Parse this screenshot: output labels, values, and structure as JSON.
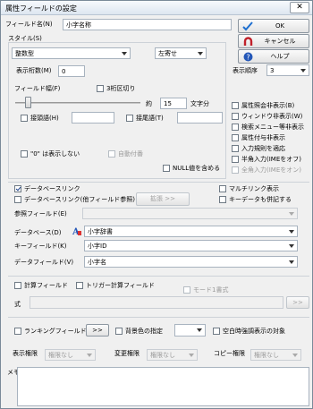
{
  "window": {
    "title": "属性フィールドの設定",
    "close_glyph": "✕"
  },
  "field_name": {
    "label": "フィールド名(N)",
    "value": "小字名称"
  },
  "buttons": {
    "ok": "OK",
    "cancel": "キャンセル",
    "help": "ヘルプ",
    "expand": "拡張 >>",
    "more": ">>"
  },
  "style": {
    "group_label": "スタイル(S)",
    "type_value": "整数型",
    "align_value": "左寄せ",
    "display_digits_label": "表示桁数(M)",
    "display_digits_value": "0",
    "field_width_label": "フィールド幅(F)",
    "thousands_sep_label": "3桁区切り",
    "approx_label": "約",
    "width_value": "15",
    "chars_unit": "文字分",
    "prefix_label": "接頭語(H)",
    "suffix_label": "接尾語(T)",
    "hide_zero_label": "\"0\" は表示しない",
    "auto_number_label": "自動付番",
    "null_include_label": "NULL値を含める"
  },
  "display_order": {
    "label": "表示順序",
    "value": "3"
  },
  "options": [
    {
      "label": "属性照会非表示(B)",
      "checked": false,
      "disabled": false
    },
    {
      "label": "ウィンドウ非表示(W)",
      "checked": false,
      "disabled": false
    },
    {
      "label": "検索メニュー等非表示",
      "checked": false,
      "disabled": false
    },
    {
      "label": "属性付与非表示",
      "checked": false,
      "disabled": false
    },
    {
      "label": "入力規則を適応",
      "checked": false,
      "disabled": false
    },
    {
      "label": "半角入力(IMEをオフ)",
      "checked": false,
      "disabled": false
    },
    {
      "label": "全角入力(IMEをオン)",
      "checked": false,
      "disabled": true
    }
  ],
  "db_link": {
    "db_link_label": "データベースリンク",
    "other_field_link_label": "データベースリンク(他フィールド参照)",
    "multi_link_label": "マルチリンク表示",
    "key_data_label": "キーデータも併記する",
    "ref_field_label": "参照フィールド(E)",
    "database_label": "データベース(D)",
    "database_value": "小字辞書",
    "key_field_label": "キーフィールド(K)",
    "key_field_value": "小字ID",
    "data_field_label": "データフィールド(V)",
    "data_field_value": "小字名"
  },
  "calc": {
    "calc_field_label": "計算フィールド",
    "trigger_calc_label": "トリガー計算フィールド",
    "mode1_label": "モード1書式",
    "formula_label": "式"
  },
  "misc": {
    "ranking_label": "ランキングフィールド",
    "bg_color_label": "背景色の指定",
    "blank_emphasis_label": "空白時強調表示の対象"
  },
  "permissions": {
    "view_label": "表示権限",
    "view_value": "権限なし",
    "edit_label": "変更権限",
    "edit_value": "権限なし",
    "copy_label": "コピー権限",
    "copy_value": "権限なし"
  },
  "memo": {
    "label": "メモ"
  },
  "colors": {
    "title_bar": "#dde6f0",
    "ok_check": "#1e6fd0",
    "cancel_icon": "#c0202a",
    "help_icon": "#2457b8"
  }
}
